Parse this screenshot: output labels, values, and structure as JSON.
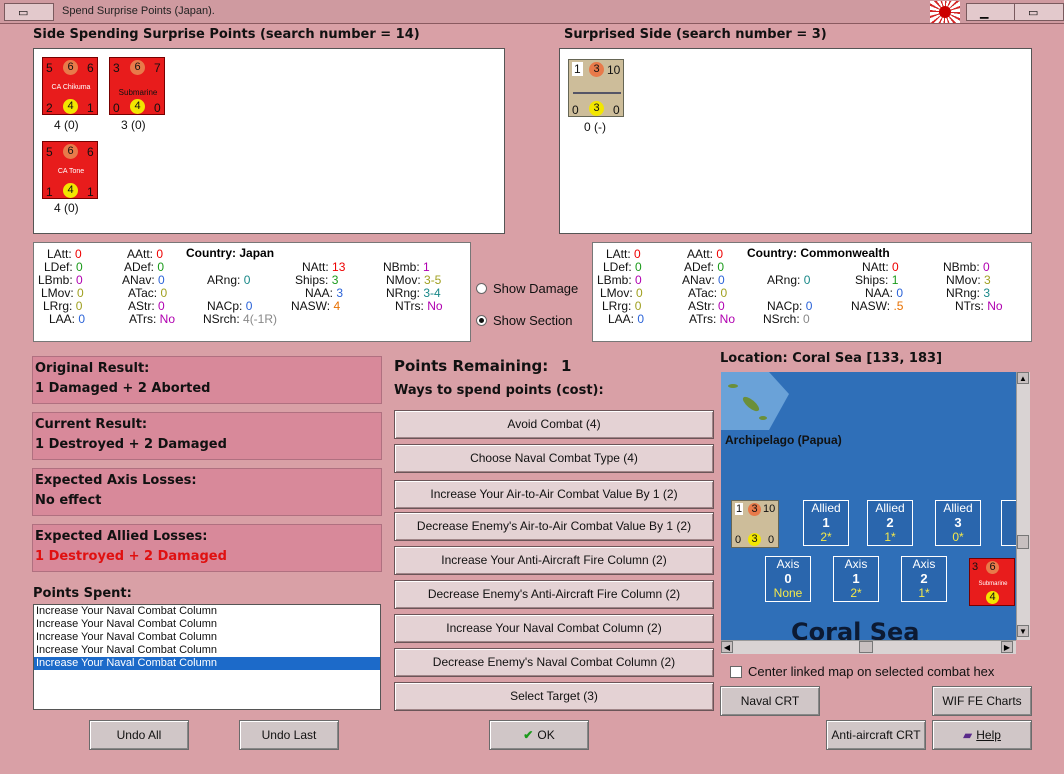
{
  "window": {
    "title": "Spend Surprise Points (Japan)."
  },
  "spending": {
    "header": "Side Spending Surprise Points (search number = 14)",
    "units": [
      {
        "tl": "5",
        "tm": "6",
        "tr": "6",
        "name": "CA Chikuma",
        "bl": "2",
        "bm": "4",
        "br": "1",
        "caption": "4 (0)"
      },
      {
        "tl": "3",
        "tm": "6",
        "tr": "7",
        "name": "Submarine",
        "bl": "0",
        "bm": "4",
        "br": "0",
        "caption": "3 (0)"
      },
      {
        "tl": "5",
        "tm": "6",
        "tr": "6",
        "name": "CA Tone",
        "bl": "1",
        "bm": "4",
        "br": "1",
        "caption": "4 (0)"
      }
    ]
  },
  "surprised": {
    "header": "Surprised Side (search number = 3)",
    "units": [
      {
        "tl": "1",
        "tm": "3",
        "tr": "10",
        "bl": "0",
        "bm": "3",
        "br": "0",
        "caption": "0 (-)"
      }
    ]
  },
  "stats_left": {
    "LAtt": "0",
    "LDef": "0",
    "LBmb": "0",
    "LMov": "0",
    "LRrg": "0",
    "LAA": "0",
    "AAtt": "0",
    "ADef": "0",
    "ANav": "0",
    "ATac": "0",
    "AStr": "0",
    "ATrs": "No",
    "country_label": "Country:",
    "country": "Japan",
    "ARng": "0",
    "NACp": "0",
    "NSrch": "4(-1R)",
    "NAtt": "13",
    "Ships": "3",
    "NAA": "3",
    "NASW": "4",
    "NBmb": "1",
    "NMov": "3-5",
    "NRng": "3-4",
    "NTrs": "No"
  },
  "stats_right": {
    "LAtt": "0",
    "LDef": "0",
    "LBmb": "0",
    "LMov": "0",
    "LRrg": "0",
    "LAA": "0",
    "AAtt": "0",
    "ADef": "0",
    "ANav": "0",
    "ATac": "0",
    "AStr": "0",
    "ATrs": "No",
    "country_label": "Country:",
    "country": "Commonwealth",
    "ARng": "0",
    "NACp": "0",
    "NSrch": "0",
    "NAtt": "0",
    "Ships": "1",
    "NAA": "0",
    "NASW": ".5",
    "NBmb": "0",
    "NMov": "3",
    "NRng": "3",
    "NTrs": "No"
  },
  "options": {
    "show_damage": "Show Damage",
    "show_section": "Show Section"
  },
  "results": [
    {
      "title": "Original Result:",
      "value": "1 Damaged + 2 Aborted"
    },
    {
      "title": "Current Result:",
      "value": "1 Destroyed + 2 Damaged"
    },
    {
      "title": "Expected Axis Losses:",
      "value": "No effect"
    },
    {
      "title": "Expected Allied Losses:",
      "value": "1 Destroyed + 2 Damaged"
    }
  ],
  "points_spent": {
    "label": "Points Spent:",
    "items": [
      "Increase Your Naval Combat Column",
      "Increase Your Naval Combat Column",
      "Increase Your Naval Combat Column",
      "Increase Your Naval Combat Column",
      "Increase Your Naval Combat Column"
    ]
  },
  "points": {
    "remaining_label": "Points Remaining:",
    "remaining": "1",
    "ways_label": "Ways to spend points (cost):"
  },
  "spend_buttons": [
    "Avoid Combat (4)",
    "Choose Naval Combat Type (4)",
    "Increase Your Air-to-Air Combat Value By 1 (2)",
    "Decrease Enemy's Air-to-Air Combat Value By 1 (2)",
    "Increase Your Anti-Aircraft Fire Column (2)",
    "Decrease Enemy's Anti-Aircraft Fire Column (2)",
    "Increase Your Naval Combat Column (2)",
    "Decrease Enemy's Naval Combat Column (2)",
    "Select Target (3)"
  ],
  "map": {
    "location": "Location: Coral Sea [133, 183]",
    "archipelago": "Archipelago (Papua)",
    "sea_name": "Coral Sea",
    "allied_boxes": [
      {
        "label": "Allied",
        "num": "1",
        "val": "2*"
      },
      {
        "label": "Allied",
        "num": "2",
        "val": "1*"
      },
      {
        "label": "Allied",
        "num": "3",
        "val": "0*"
      }
    ],
    "axis_boxes": [
      {
        "label": "Axis",
        "num": "0",
        "val": "None"
      },
      {
        "label": "Axis",
        "num": "1",
        "val": "2*"
      },
      {
        "label": "Axis",
        "num": "2",
        "val": "1*"
      }
    ],
    "map_counter": {
      "tl": "1",
      "tm": "3",
      "tr": "10",
      "bl": "0",
      "bm": "3",
      "br": "0"
    },
    "map_sub": {
      "tl": "3",
      "tm": "6",
      "name": "Submarine",
      "bm": "4"
    },
    "center_checkbox": "Center linked map on selected combat hex"
  },
  "bottom": {
    "undo_all": "Undo All",
    "undo_last": "Undo Last",
    "ok": "OK",
    "naval_crt": "Naval CRT",
    "wif_charts": "WIF FE Charts",
    "aa_crt": "Anti-aircraft CRT",
    "help": "Help"
  }
}
